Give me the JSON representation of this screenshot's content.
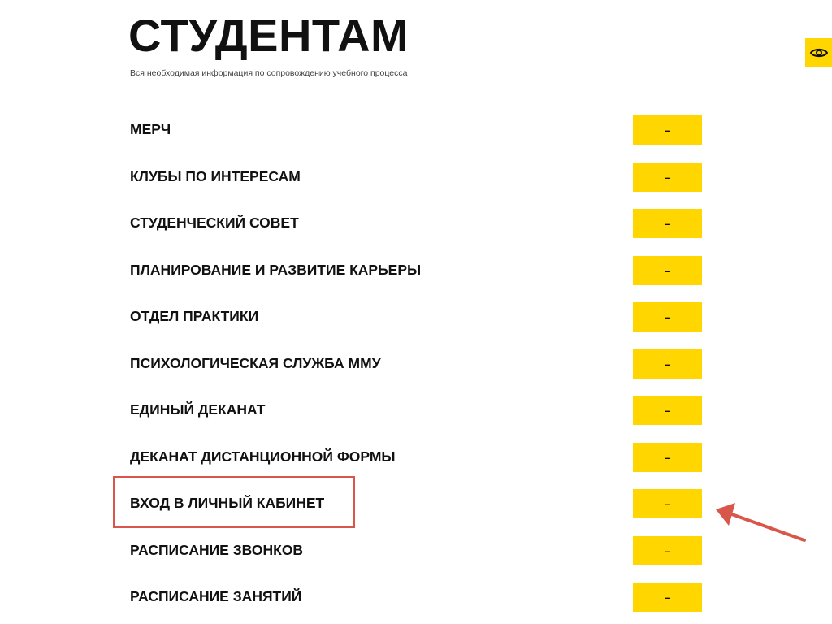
{
  "header": {
    "title": "СТУДЕНТАМ",
    "subtitle": "Вся необходимая информация по сопровождению учебного процесса"
  },
  "accessibility": {
    "icon": "eye-icon",
    "color": "#ffd600"
  },
  "theme": {
    "accent": "#ffd600",
    "highlight": "#d9574a"
  },
  "menu": {
    "toggle_symbol": "–",
    "items": [
      {
        "label": "МЕРЧ"
      },
      {
        "label": "КЛУБЫ ПО ИНТЕРЕСАМ"
      },
      {
        "label": "СТУДЕНЧЕСКИЙ СОВЕТ"
      },
      {
        "label": "ПЛАНИРОВАНИЕ И РАЗВИТИЕ КАРЬЕРЫ"
      },
      {
        "label": "ОТДЕЛ ПРАКТИКИ"
      },
      {
        "label": "ПСИХОЛОГИЧЕСКАЯ СЛУЖБА ММУ"
      },
      {
        "label": "ЕДИНЫЙ ДЕКАНАТ"
      },
      {
        "label": "ДЕКАНАТ ДИСТАНЦИОННОЙ ФОРМЫ"
      },
      {
        "label": "ВХОД В ЛИЧНЫЙ КАБИНЕТ"
      },
      {
        "label": "РАСПИСАНИЕ ЗВОНКОВ"
      },
      {
        "label": "РАСПИСАНИЕ ЗАНЯТИЙ"
      }
    ]
  }
}
